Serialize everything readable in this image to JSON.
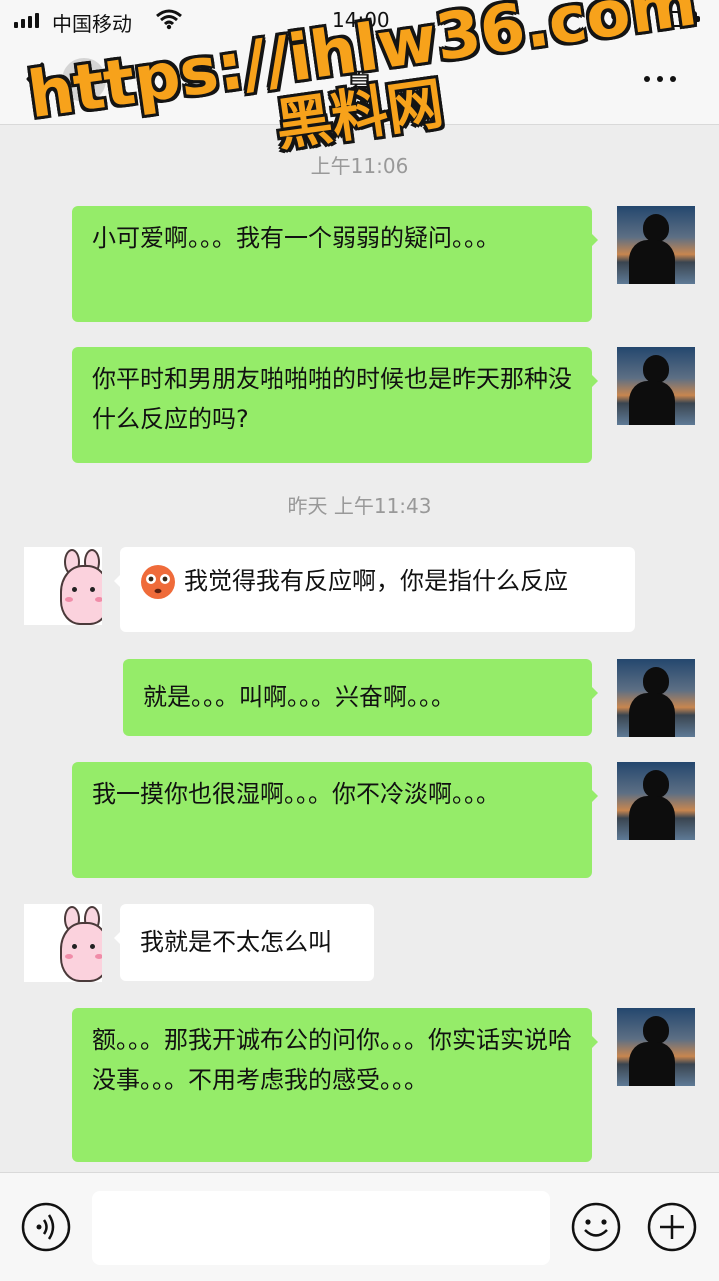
{
  "status_bar": {
    "carrier": "中国移动",
    "time": "14:00",
    "battery_percent_text": "%",
    "battery_level": 0.3
  },
  "nav": {
    "unread_count": "7",
    "title": "夏"
  },
  "watermark": {
    "line1": "https://ihlw36.com",
    "line2": "黑料网"
  },
  "chat": {
    "timestamps": [
      "上午11:06",
      "昨天 上午11:43"
    ],
    "messages": [
      {
        "from": "self",
        "text": "小可爱啊。。。我有一个弱弱的疑问。。。"
      },
      {
        "from": "self",
        "text": "你平时和男朋友啪啪啪的时候也是昨天那种没什么反应的吗?"
      },
      {
        "from": "other",
        "emoji": "flushed-face",
        "text": "我觉得我有反应啊，你是指什么反应"
      },
      {
        "from": "self",
        "text": "就是。。。叫啊。。。兴奋啊。。。"
      },
      {
        "from": "self",
        "text": "我一摸你也很湿啊。。。你不冷淡啊。。。"
      },
      {
        "from": "other",
        "text": "我就是不太怎么叫"
      },
      {
        "from": "self",
        "text": "额。。。那我开诚布公的问你。。。你实话实说哈没事。。。不用考虑我的感受。。。"
      }
    ]
  },
  "input_bar": {
    "input_value": "",
    "icons": [
      "voice-icon",
      "emoji-icon",
      "plus-icon"
    ]
  },
  "colors": {
    "self_bubble": "#95ec69",
    "other_bubble": "#ffffff",
    "background": "#ededed",
    "watermark": "#f7a21b"
  }
}
